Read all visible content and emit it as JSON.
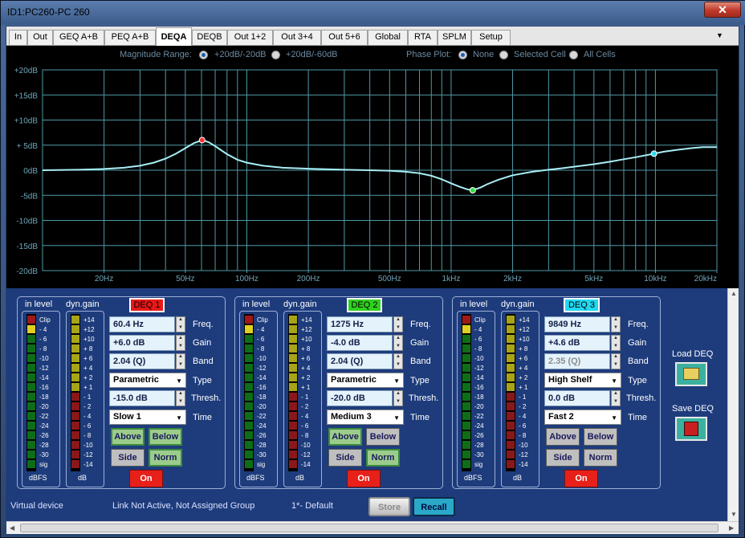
{
  "window": {
    "title": "ID1:PC260-PC 260",
    "close_glyph": "✕"
  },
  "tabs": [
    "In",
    "Out",
    "GEQ A+B",
    "PEQ A+B",
    "DEQA",
    "DEQB",
    "Out 1+2",
    "Out 3+4",
    "Out 5+6",
    "Global",
    "RTA",
    "SPLM",
    "Setup"
  ],
  "active_tab": "DEQA",
  "tab_overflow_glyph": "▼",
  "options": {
    "magnitude_label": "Magnitude Range:",
    "magnitude_choices": [
      "+20dB/-20dB",
      "+20dB/-60dB"
    ],
    "magnitude_selected": 0,
    "phase_label": "Phase Plot:",
    "phase_choices": [
      "None",
      "Selected Cell",
      "All Cells"
    ],
    "phase_selected": 0
  },
  "chart_data": {
    "type": "line",
    "x_scale": "log",
    "xlim": [
      10,
      20000
    ],
    "ylim": [
      -20,
      20
    ],
    "grid": true,
    "y_ticks": [
      20,
      15,
      10,
      5,
      0,
      -5,
      -10,
      -15,
      -20
    ],
    "y_tick_labels": [
      "+20dB",
      "+15dB",
      "+10dB",
      "+ 5dB",
      "0dB",
      "-5dB",
      "-10dB",
      "-15dB",
      "-20dB"
    ],
    "x_tick_labels": [
      {
        "value": 20,
        "label": "20Hz"
      },
      {
        "value": 50,
        "label": "50Hz"
      },
      {
        "value": 100,
        "label": "100Hz"
      },
      {
        "value": 200,
        "label": "200Hz"
      },
      {
        "value": 500,
        "label": "500Hz"
      },
      {
        "value": 1000,
        "label": "1kHz"
      },
      {
        "value": 2000,
        "label": "2kHz"
      },
      {
        "value": 5000,
        "label": "5kHz"
      },
      {
        "value": 10000,
        "label": "10kHz"
      },
      {
        "value": 20000,
        "label": "20kHz"
      }
    ],
    "curve_color": "#a8eef6",
    "grid_color": "#4f9aa8",
    "series": [
      {
        "x": [
          10,
          15,
          20,
          25,
          30,
          35,
          40,
          45,
          50,
          55,
          60.4,
          65,
          70,
          80,
          90,
          100,
          120,
          150,
          200,
          300,
          400,
          500,
          600,
          700,
          800,
          900,
          1000,
          1100,
          1200,
          1275,
          1400,
          1500,
          1700,
          2000,
          2500,
          3000,
          3500,
          4000,
          5000,
          6000,
          7000,
          8000,
          9849,
          11000,
          13000,
          15000,
          17000,
          20000
        ],
        "y": [
          0,
          0.1,
          0.25,
          0.5,
          0.9,
          1.5,
          2.3,
          3.3,
          4.4,
          5.4,
          6.0,
          5.6,
          4.8,
          3.2,
          2.1,
          1.5,
          0.9,
          0.5,
          0.3,
          0.1,
          0,
          -0.1,
          -0.3,
          -0.6,
          -1.1,
          -1.8,
          -2.6,
          -3.3,
          -3.8,
          -4.0,
          -3.4,
          -2.8,
          -1.9,
          -1.0,
          -0.3,
          0.1,
          0.4,
          0.7,
          1.2,
          1.7,
          2.2,
          2.6,
          3.3,
          3.7,
          4.1,
          4.4,
          4.6,
          4.6
        ]
      }
    ],
    "markers": [
      {
        "x": 60.4,
        "y": 6.0,
        "color": "#ff3030"
      },
      {
        "x": 1275,
        "y": -4.0,
        "color": "#30e040"
      },
      {
        "x": 9849,
        "y": 3.3,
        "color": "#30d8f0"
      }
    ]
  },
  "meter_labels": {
    "in_level": "in level",
    "dyn_gain": "dyn.gain",
    "dbfs": "dBFS",
    "db": "dB",
    "in_ticks": [
      "Clip",
      "- 4",
      "- 6",
      "- 8",
      "-10",
      "-12",
      "-14",
      "-16",
      "-18",
      "-20",
      "-22",
      "-24",
      "-26",
      "-28",
      "-30",
      "sig"
    ],
    "gain_ticks": [
      "+14",
      "+12",
      "+10",
      "+ 8",
      "+ 6",
      "+ 4",
      "+ 2",
      "+ 1",
      "- 1",
      "- 2",
      "- 4",
      "- 6",
      "- 8",
      "-10",
      "-12",
      "-14"
    ],
    "in_level_lit": [
      "#a01818",
      "#e0d020",
      "#0e6e16",
      "#0e6e16",
      "#0e6e16",
      "#0e6e16",
      "#0e6e16",
      "#0e6e16",
      "#0e6e16",
      "#0e6e16",
      "#0e6e16",
      "#0e6e16",
      "#0e6e16",
      "#0e6e16",
      "#0e6e16",
      "#0e6e16"
    ],
    "gain_lit": [
      "#a8a418",
      "#a8a418",
      "#a8a418",
      "#a8a418",
      "#a8a418",
      "#a8a418",
      "#a8a418",
      "#a8a418",
      "#8a1818",
      "#8a1818",
      "#8a1818",
      "#8a1818",
      "#8a1818",
      "#8a1818",
      "#8a1818",
      "#8a1818"
    ]
  },
  "param_labels": {
    "freq": "Freq.",
    "gain": "Gain",
    "band": "Band",
    "type": "Type",
    "thresh": "Thresh.",
    "time": "Time"
  },
  "bands": [
    {
      "name": "DEQ 1",
      "color": "#e81818",
      "text_color": "#000",
      "freq": "60.4 Hz",
      "gain": "+6.0 dB",
      "band": "2.04 (Q)",
      "band_disabled": false,
      "type": "Parametric",
      "thresh": "-15.0 dB",
      "time": "Slow 1",
      "above": "Above",
      "below": "Below",
      "side": "Side",
      "norm": "Norm",
      "on": "On",
      "above_on": true,
      "below_on": true,
      "side_on": false,
      "norm_on": true
    },
    {
      "name": "DEQ 2",
      "color": "#30d020",
      "text_color": "#000",
      "freq": "1275 Hz",
      "gain": "-4.0 dB",
      "band": "2.04 (Q)",
      "band_disabled": false,
      "type": "Parametric",
      "thresh": "-20.0 dB",
      "time": "Medium 3",
      "above": "Above",
      "below": "Below",
      "side": "Side",
      "norm": "Norm",
      "on": "On",
      "above_on": true,
      "below_on": false,
      "side_on": false,
      "norm_on": true
    },
    {
      "name": "DEQ 3",
      "color": "#20d8f0",
      "text_color": "#000",
      "freq": "9849 Hz",
      "gain": "+4.6 dB",
      "band": "2.35 (Q)",
      "band_disabled": true,
      "type": "High Shelf",
      "thresh": "0.0 dB",
      "time": "Fast 2",
      "above": "Above",
      "below": "Below",
      "side": "Side",
      "norm": "Norm",
      "on": "On",
      "above_on": false,
      "below_on": false,
      "side_on": false,
      "norm_on": false
    }
  ],
  "side_actions": {
    "load": "Load DEQ",
    "save": "Save DEQ"
  },
  "status": {
    "device": "Virtual device",
    "link": "Link Not Active,  Not Assigned Group",
    "preset": "1*- Default",
    "store": "Store",
    "recall": "Recall"
  }
}
